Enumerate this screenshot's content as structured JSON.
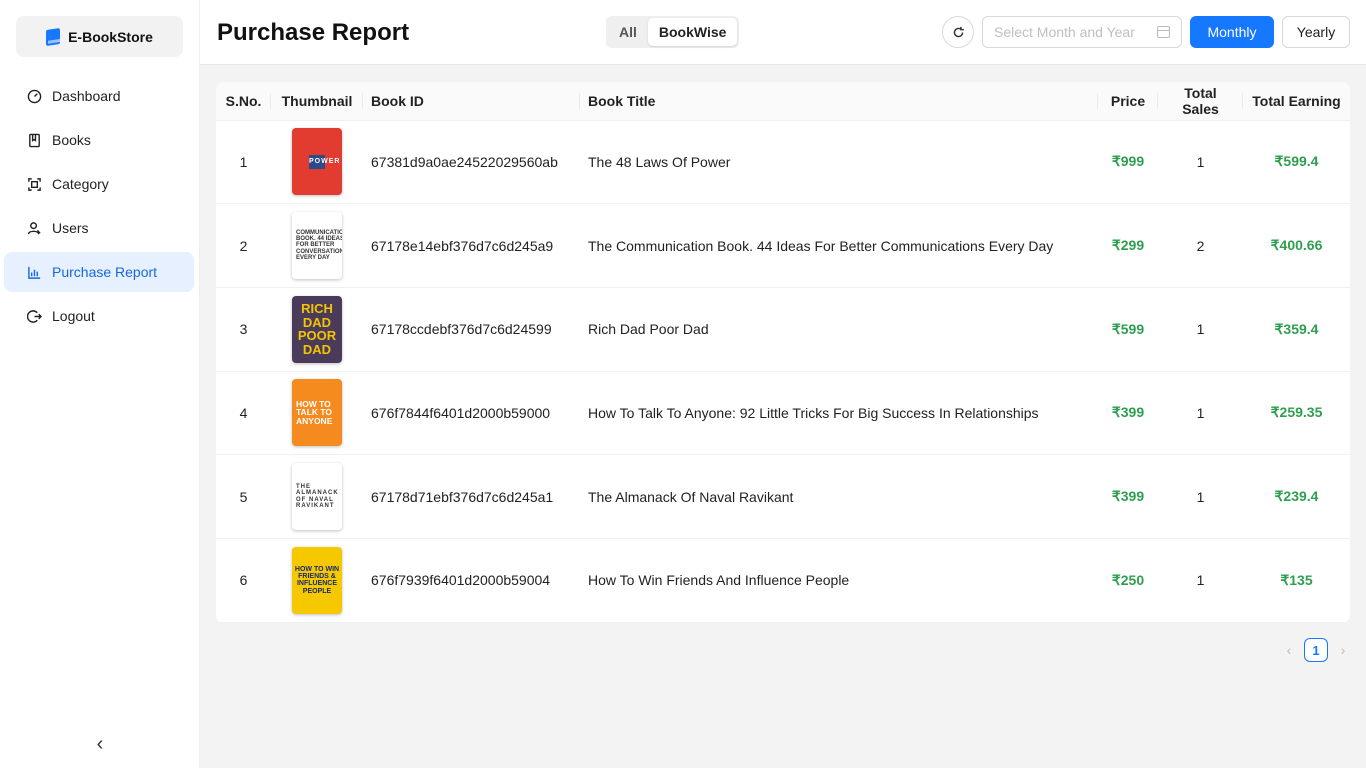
{
  "app": {
    "name": "E-BookStore"
  },
  "sidebar": {
    "items": [
      {
        "label": "Dashboard",
        "icon": "dashboard-icon"
      },
      {
        "label": "Books",
        "icon": "book-icon"
      },
      {
        "label": "Category",
        "icon": "category-icon"
      },
      {
        "label": "Users",
        "icon": "users-icon"
      },
      {
        "label": "Purchase Report",
        "icon": "chart-icon",
        "active": true
      },
      {
        "label": "Logout",
        "icon": "logout-icon"
      }
    ],
    "collapse_glyph": "‹"
  },
  "header": {
    "title": "Purchase Report",
    "segments": {
      "all": "All",
      "bookwise": "BookWise",
      "selected": "BookWise"
    },
    "date_placeholder": "Select Month and Year",
    "monthly_label": "Monthly",
    "yearly_label": "Yearly"
  },
  "table": {
    "columns": {
      "sno": "S.No.",
      "thumbnail": "Thumbnail",
      "book_id": "Book ID",
      "book_title": "Book Title",
      "price": "Price",
      "total_sales": "Total Sales",
      "total_earning": "Total Earning"
    },
    "rows": [
      {
        "sno": "1",
        "book_id": "67381d9a0ae24522029560ab",
        "title": "The 48 Laws Of Power",
        "price": "₹999",
        "sales": "1",
        "earning": "₹599.4"
      },
      {
        "sno": "2",
        "book_id": "67178e14ebf376d7c6d245a9",
        "title": "The Communication Book. 44 Ideas For Better Communications Every Day",
        "price": "₹299",
        "sales": "2",
        "earning": "₹400.66"
      },
      {
        "sno": "3",
        "book_id": "67178ccdebf376d7c6d24599",
        "title": "Rich Dad Poor Dad",
        "price": "₹599",
        "sales": "1",
        "earning": "₹359.4"
      },
      {
        "sno": "4",
        "book_id": "676f7844f6401d2000b59000",
        "title": "How To Talk To Anyone: 92 Little Tricks For Big Success In Relationships",
        "price": "₹399",
        "sales": "1",
        "earning": "₹259.35"
      },
      {
        "sno": "5",
        "book_id": "67178d71ebf376d7c6d245a1",
        "title": "The Almanack Of Naval Ravikant",
        "price": "₹399",
        "sales": "1",
        "earning": "₹239.4"
      },
      {
        "sno": "6",
        "book_id": "676f7939f6401d2000b59004",
        "title": "How To Win Friends And Influence People",
        "price": "₹250",
        "sales": "1",
        "earning": "₹135"
      }
    ],
    "covers": [
      {
        "text": "POWER"
      },
      {
        "text": "COMMUNICATION BOOK. 44 IDEAS FOR BETTER CONVERSATIONS EVERY DAY"
      },
      {
        "text": "RICH DAD POOR DAD"
      },
      {
        "text": "HOW TO TALK TO ANYONE"
      },
      {
        "text": "THE ALMANACK OF NAVAL RAVIKANT"
      },
      {
        "text": "HOW TO WIN FRIENDS & INFLUENCE PEOPLE"
      }
    ]
  },
  "pagination": {
    "prev": "‹",
    "current": "1",
    "next": "›"
  },
  "colors": {
    "primary": "#1677ff",
    "earning_green": "#2e9e4f",
    "active_nav_bg": "#e6f0ff"
  }
}
